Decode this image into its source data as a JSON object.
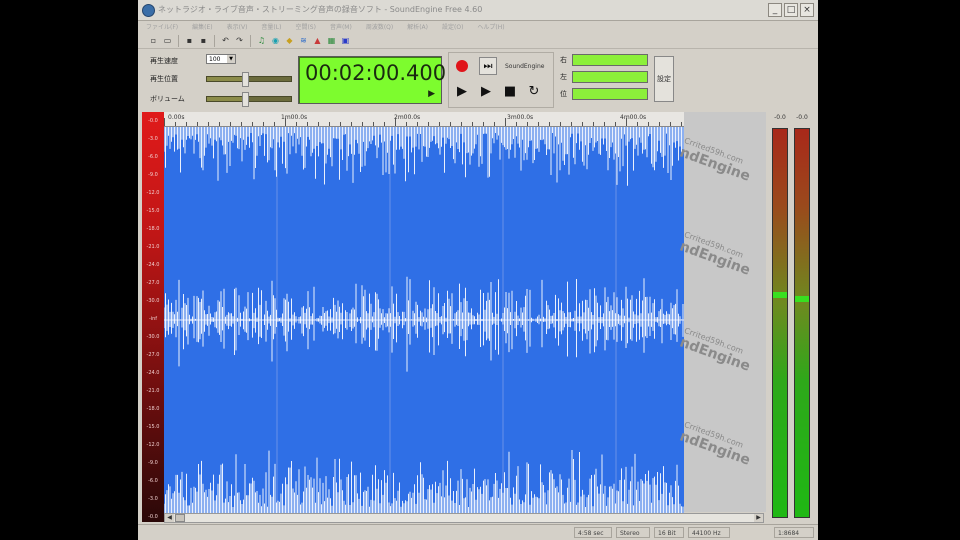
{
  "window": {
    "title": "ネットラジオ・ライブ音声・ストリーミング音声の録音ソフト - SoundEngine Free 4.60",
    "controls": {
      "minimize": "_",
      "maximize": "□",
      "close": "×"
    }
  },
  "menu": [
    "ファイル(F)",
    "編集(E)",
    "表示(V)",
    "音量(L)",
    "空間(S)",
    "音声(M)",
    "周波数(Q)",
    "解析(A)",
    "設定(O)",
    "ヘルプ(H)"
  ],
  "toolbar": {
    "icons": [
      "new-file-icon",
      "open-folder-icon",
      "save-icon",
      "save-as-icon",
      "undo-icon",
      "redo-icon",
      "mic-icon",
      "speaker-icon",
      "record-settings-icon",
      "eq-icon",
      "volume-icon",
      "chart-icon",
      "settings-icon"
    ]
  },
  "controls": {
    "playback_rate_label": "再生速度",
    "playback_rate_value": "100",
    "playback_pos_label": "再生位置",
    "volume_label": "ボリューム",
    "playback_pos_value": 0.45,
    "volume_value": 0.45
  },
  "time_display": {
    "value": "00:02:00.400",
    "play_glyph": "▶"
  },
  "transport": {
    "brand": "SoundEngine",
    "record": "record",
    "skip_end": "⏭",
    "play": "▶",
    "play_selection": "▶",
    "stop": "■",
    "loop": "↻"
  },
  "level_meters": [
    {
      "label": "右"
    },
    {
      "label": "左"
    },
    {
      "label": "位"
    }
  ],
  "side_button": "設定",
  "ruler": {
    "labels": [
      "0.00s",
      "1m00.0s",
      "2m00.0s",
      "3m00.0s",
      "4m00.0s"
    ]
  },
  "left_vu_ticks": [
    "-0.0",
    "-3.0",
    "-6.0",
    "-9.0",
    "-12.0",
    "-15.0",
    "-18.0",
    "-21.0",
    "-24.0",
    "-27.0",
    "-30.0",
    "-inf",
    "-30.0",
    "-27.0",
    "-24.0",
    "-21.0",
    "-18.0",
    "-15.0",
    "-12.0",
    "-9.0",
    "-6.0",
    "-3.0",
    "-0.0"
  ],
  "watermark": {
    "top": "Crrited59h.com",
    "bottom": "ndEngine"
  },
  "right_vu": {
    "left_head": "-0.0",
    "right_head": "-0.0",
    "left_peak_level": 0.58,
    "right_peak_level": 0.57
  },
  "status": {
    "time": "4:58 sec",
    "channels": "Stereo",
    "bits": "16 Bit",
    "rate": "44100 Hz",
    "zoom": "1:8684"
  }
}
